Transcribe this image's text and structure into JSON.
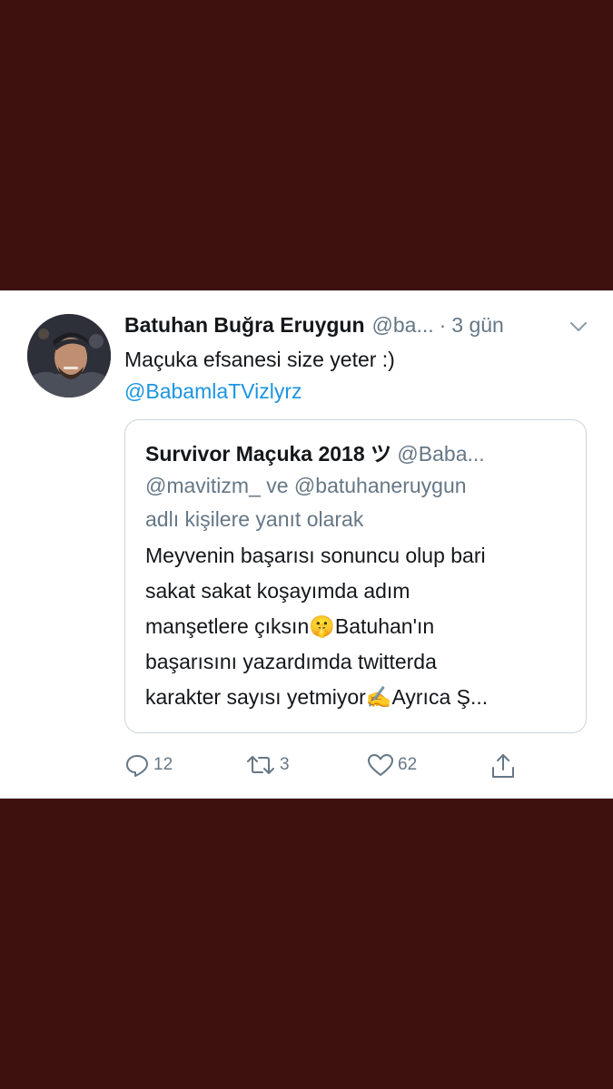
{
  "tweet": {
    "display_name": "Batuhan Buğra Eruygun",
    "handle": "@ba...",
    "separator": "·",
    "time": "3 gün",
    "text": "Maçuka efsanesi size yeter :)",
    "mention": "@BabamlaTVizlyrz"
  },
  "quoted_tweet": {
    "display_name": "Survivor Maçuka 2018 ツ",
    "handle": "@Baba...",
    "reply_line1": "@mavitizm_ ve @batuhaneruygun",
    "reply_line2": "adlı kişilere yanıt olarak",
    "body_lines": [
      "Meyvenin başarısı sonuncu olup bari",
      "sakat sakat koşayımda adım",
      "manşetlere çıksın🤫Batuhan'ın",
      "başarısını yazardımda twitterda",
      "karakter sayısı yetmiyor✍️Ayrıca Ş..."
    ]
  },
  "actions": {
    "reply_count": "12",
    "retweet_count": "3",
    "like_count": "62"
  },
  "colors": {
    "background": "#3e110f",
    "link": "#1b95e0",
    "secondary_text": "#657786"
  }
}
